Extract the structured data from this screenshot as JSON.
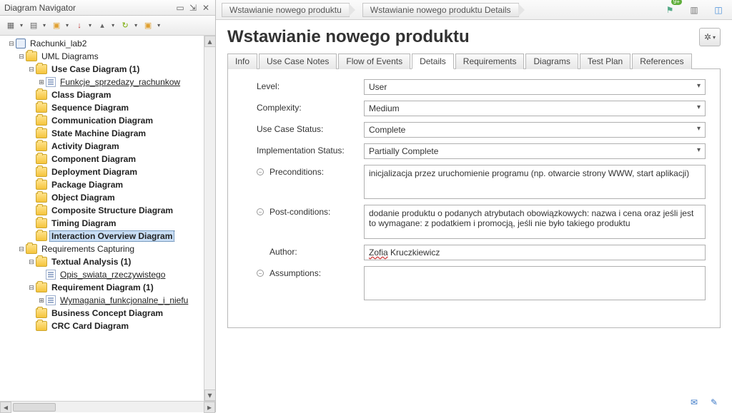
{
  "navigator": {
    "title": "Diagram Navigator",
    "root": "Rachunki_lab2",
    "uml_group": "UML Diagrams",
    "items": [
      {
        "label": "Use Case Diagram (1)",
        "bold": true,
        "twisty": "minus"
      },
      {
        "label": "Funkcje_sprzedazy_rachunkow",
        "child": true,
        "link": true,
        "twisty": "plus"
      },
      {
        "label": "Class Diagram",
        "bold": true,
        "twisty": "none"
      },
      {
        "label": "Sequence Diagram",
        "bold": true,
        "twisty": "none"
      },
      {
        "label": "Communication Diagram",
        "bold": true,
        "twisty": "none"
      },
      {
        "label": "State Machine Diagram",
        "bold": true,
        "twisty": "none"
      },
      {
        "label": "Activity Diagram",
        "bold": true,
        "twisty": "none"
      },
      {
        "label": "Component Diagram",
        "bold": true,
        "twisty": "none"
      },
      {
        "label": "Deployment Diagram",
        "bold": true,
        "twisty": "none"
      },
      {
        "label": "Package Diagram",
        "bold": true,
        "twisty": "none"
      },
      {
        "label": "Object Diagram",
        "bold": true,
        "twisty": "none"
      },
      {
        "label": "Composite Structure Diagram",
        "bold": true,
        "twisty": "none"
      },
      {
        "label": "Timing Diagram",
        "bold": true,
        "twisty": "none"
      },
      {
        "label": "Interaction Overview Diagram",
        "bold": true,
        "twisty": "none",
        "selected": true
      }
    ],
    "req_group": "Requirements Capturing",
    "req_items": [
      {
        "label": "Textual Analysis (1)",
        "bold": true,
        "twisty": "minus"
      },
      {
        "label": "Opis_swiata_rzeczywistego",
        "child": true,
        "link": true,
        "twisty": "none"
      },
      {
        "label": "Requirement Diagram (1)",
        "bold": true,
        "twisty": "minus"
      },
      {
        "label": "Wymagania_funkcjonalne_i_niefu",
        "child": true,
        "link": true,
        "twisty": "plus"
      },
      {
        "label": "Business Concept Diagram",
        "bold": true,
        "twisty": "none"
      },
      {
        "label": "CRC Card Diagram",
        "bold": true,
        "twisty": "none"
      }
    ]
  },
  "breadcrumb": {
    "items": [
      "Wstawianie nowego produktu",
      "Wstawianie nowego produktu Details"
    ],
    "badge": "9+"
  },
  "page_title": "Wstawianie nowego produktu",
  "tabs": [
    "Info",
    "Use Case Notes",
    "Flow of Events",
    "Details",
    "Requirements",
    "Diagrams",
    "Test Plan",
    "References"
  ],
  "active_tab": 3,
  "form": {
    "level_label": "Level:",
    "level_value": "User",
    "complexity_label": "Complexity:",
    "complexity_value": "Medium",
    "ucstatus_label": "Use Case Status:",
    "ucstatus_value": "Complete",
    "implstatus_label": "Implementation Status:",
    "implstatus_value": "Partially Complete",
    "precond_label": "Preconditions:",
    "precond_value": "inicjalizacja przez uruchomienie programu (np. otwarcie strony WWW, start aplikacji)",
    "postcond_label": "Post-conditions:",
    "postcond_value": "dodanie produktu o podanych atrybutach obowiązkowych: nazwa i cena oraz jeśli jest to wymagane: z podatkiem i promocją, jeśli nie było takiego produktu",
    "author_label": "Author:",
    "author_first": "Zofia",
    "author_last": " Kruczkiewicz",
    "assumptions_label": "Assumptions:",
    "assumptions_value": ""
  }
}
